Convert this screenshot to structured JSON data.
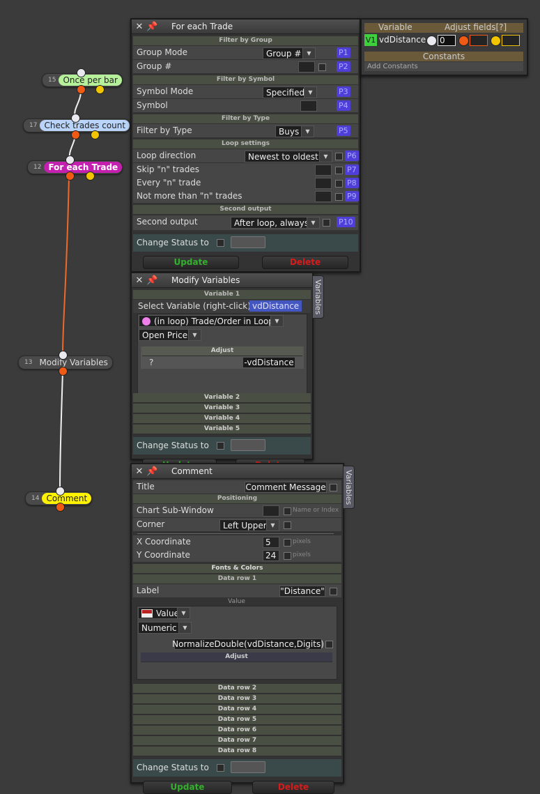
{
  "nodes": [
    {
      "num": "15",
      "label": "Once per bar"
    },
    {
      "num": "17",
      "label": "Check trades count"
    },
    {
      "num": "12",
      "label": "For each Trade"
    },
    {
      "num": "13",
      "label": "Modify Variables"
    },
    {
      "num": "14",
      "label": "Comment"
    }
  ],
  "colors": {
    "accent_green": "#b7f09a",
    "accent_blue": "#b9d4f8",
    "accent_magenta": "#c51fb0",
    "accent_yellow": "#fff200",
    "update": "#33b02c",
    "delete": "#d81b1b"
  },
  "icons": {
    "close": "close-icon",
    "pin": "pin-icon",
    "dropdown": "chevron-down-icon"
  },
  "foreach": {
    "title": "For each Trade",
    "sections": {
      "group": "Filter by Group",
      "symbol": "Filter by Symbol",
      "type": "Filter by Type",
      "loop": "Loop settings",
      "second": "Second output"
    },
    "group_mode_label": "Group Mode",
    "group_mode_value": "Group #",
    "group_mode_p": "P1",
    "group_num_label": "Group #",
    "group_num_p": "P2",
    "symbol_mode_label": "Symbol Mode",
    "symbol_mode_value": "Specified",
    "symbol_mode_p": "P3",
    "symbol_label": "Symbol",
    "symbol_p": "P4",
    "type_label": "Filter by Type",
    "type_value": "Buys",
    "type_p": "P5",
    "loop_dir_label": "Loop direction",
    "loop_dir_value": "Newest to oldest",
    "loop_dir_p": "P6",
    "skip_label": "Skip \"n\" trades",
    "skip_p": "P7",
    "every_label": "Every \"n\" trade",
    "every_p": "P8",
    "notmore_label": "Not more than \"n\" trades",
    "notmore_p": "P9",
    "second_label": "Second output",
    "second_value": "After loop, always",
    "second_p": "P10",
    "status_label": "Change Status to",
    "update": "Update",
    "delete": "Delete"
  },
  "variables_panel": {
    "col_variable": "Variable",
    "col_adjust": "Adjust fields[?]",
    "v_badge": "V1",
    "v_name": "vdDistance",
    "v_value": "0",
    "constants": "Constants",
    "add_constants": "Add Constants"
  },
  "modify": {
    "title": "Modify Variables",
    "tab": "Variables",
    "var1": "Variable 1",
    "select_label": "Select Variable (right-click)",
    "select_value": "vdDistance",
    "source_value": "(in loop) Trade/Order in Loop",
    "field_value": "Open Price",
    "adjust_header": "Adjust",
    "adjust_op": "?",
    "adjust_value": "-vdDistance",
    "collapsed": [
      "Variable 2",
      "Variable 3",
      "Variable 4",
      "Variable 5"
    ],
    "status_label": "Change Status to",
    "update": "Update",
    "delete": "Delete"
  },
  "comment": {
    "title": "Comment",
    "tab": "Variables",
    "title_label": "Title",
    "title_value": "Comment Message",
    "positioning": "Positioning",
    "subwindow_label": "Chart Sub-Window",
    "subwindow_hint": "Name or Index",
    "corner_label": "Corner",
    "corner_value": "Left Upper",
    "x_label": "X Coordinate",
    "x_value": "5",
    "x_unit": "pixels",
    "y_label": "Y Coordinate",
    "y_value": "24",
    "y_unit": "pixels",
    "fonts": "Fonts & Colors",
    "datarow1": "Data row 1",
    "label_label": "Label",
    "label_value": "\"Distance\"",
    "value_header": "Value",
    "value_type": "Value",
    "value_format": "Numeric",
    "value_expr": "NormalizeDouble(vdDistance,Digits)",
    "adjust": "Adjust",
    "collapsed": [
      "Data row 2",
      "Data row 3",
      "Data row 4",
      "Data row 5",
      "Data row 6",
      "Data row 7",
      "Data row 8"
    ],
    "status_label": "Change Status to",
    "update": "Update",
    "delete": "Delete"
  }
}
